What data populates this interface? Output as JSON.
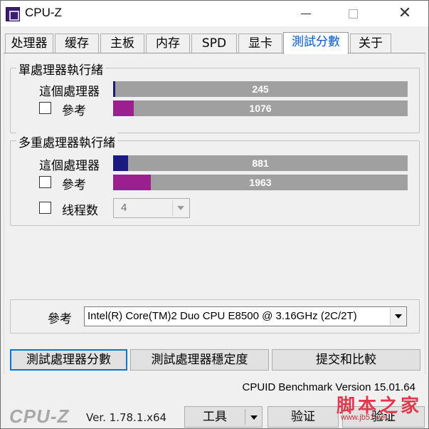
{
  "window": {
    "title": "CPU-Z"
  },
  "tabs": [
    {
      "label": "处理器"
    },
    {
      "label": "缓存"
    },
    {
      "label": "主板"
    },
    {
      "label": "内存"
    },
    {
      "label": "SPD"
    },
    {
      "label": "显卡"
    },
    {
      "label": "測試分數",
      "active": true
    },
    {
      "label": "关于"
    }
  ],
  "single_thread": {
    "group_title": "單處理器執行緒",
    "this_cpu_label": "這個處理器",
    "this_cpu_value": "245",
    "this_cpu_fraction": 0.008,
    "reference_label": "參考",
    "reference_value": "1076",
    "reference_fraction": 0.07,
    "reference_checked": false
  },
  "multi_thread": {
    "group_title": "多重處理器執行緒",
    "this_cpu_label": "這個處理器",
    "this_cpu_value": "881",
    "this_cpu_fraction": 0.05,
    "reference_label": "參考",
    "reference_value": "1963",
    "reference_fraction": 0.128,
    "reference_checked": false,
    "threads_label": "线程数",
    "threads_value": "4",
    "threads_checked": false
  },
  "reference": {
    "label": "參考",
    "selected": "Intel(R) Core(TM)2 Duo CPU E8500 @ 3.16GHz (2C/2T)"
  },
  "actions": {
    "bench_cpu": "測試處理器分數",
    "stress_cpu": "測試處理器穩定度",
    "submit": "提交和比較"
  },
  "benchmark_version": "CPUID Benchmark Version 15.01.64",
  "footer": {
    "logo": "CPU-Z",
    "version": "Ver. 1.78.1.x64",
    "tools": "工具",
    "validate": "验证",
    "ok": "验证"
  },
  "watermark": {
    "text": "脚本之家",
    "url": "www.jb51.net"
  },
  "colors": {
    "this_cpu_bar": "#1a1a80",
    "reference_bar": "#9b1f8e",
    "bar_track": "#a0a0a0",
    "active_tab_text": "#0055c8"
  }
}
